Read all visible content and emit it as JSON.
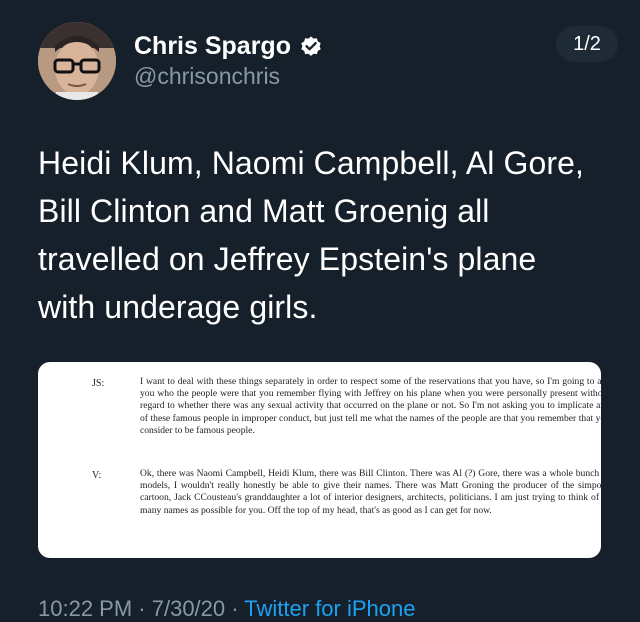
{
  "author": {
    "name": "Chris Spargo",
    "handle": "@chrisonchris",
    "avatar_icon": "user-avatar",
    "verified_icon": "verified-badge-icon"
  },
  "thread_counter": "1/2",
  "tweet": {
    "lines": [
      "Heidi Klum, Naomi Campbell, Al Gore,",
      "Bill Clinton and Matt Groenig all",
      "travelled on Jeffrey Epstein's plane",
      "with underage girls."
    ]
  },
  "document": {
    "entries": [
      {
        "speaker": "JS:",
        "text": "I want to deal with these things separately in order to respect some of the reservations that you have, so I'm going to ask you who the people were that you remember flying with Jeffrey on his plane when you were personally present without regard to whether there was any sexual activity that occurred on the plane or not. So I'm not asking you to implicate any of these famous people in improper conduct, but just tell me what the names of the people are that you remember that you consider to be famous people."
      },
      {
        "speaker": "V:",
        "text": "Ok, there was Naomi Campbell, Heidi Klum, there was Bill Clinton. There was Al (?) Gore, there was a whole bunch of models, I wouldn't really honestly be able to give their names. There was Matt Groning the producer of the simpons cartoon, Jack CCousteau's granddaughter a lot of interior designers, architects, politicians. I am just trying to think of as many names as possible for you. Off the top of my head, that's as good as I can get for now."
      }
    ]
  },
  "meta": {
    "time": "10:22 PM",
    "separator": " · ",
    "date": "7/30/20",
    "source": "Twitter for iPhone"
  },
  "colors": {
    "background": "#15202b",
    "secondary_text": "#8899a6",
    "link": "#1da1f2"
  }
}
